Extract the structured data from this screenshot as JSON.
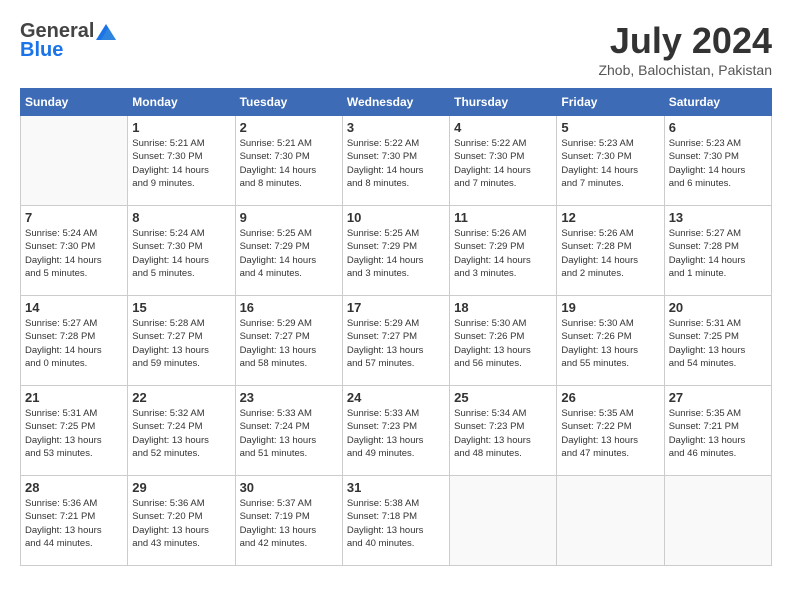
{
  "header": {
    "logo_general": "General",
    "logo_blue": "Blue",
    "month_title": "July 2024",
    "location": "Zhob, Balochistan, Pakistan"
  },
  "calendar": {
    "days_of_week": [
      "Sunday",
      "Monday",
      "Tuesday",
      "Wednesday",
      "Thursday",
      "Friday",
      "Saturday"
    ],
    "weeks": [
      [
        {
          "day": "",
          "info": ""
        },
        {
          "day": "1",
          "info": "Sunrise: 5:21 AM\nSunset: 7:30 PM\nDaylight: 14 hours\nand 9 minutes."
        },
        {
          "day": "2",
          "info": "Sunrise: 5:21 AM\nSunset: 7:30 PM\nDaylight: 14 hours\nand 8 minutes."
        },
        {
          "day": "3",
          "info": "Sunrise: 5:22 AM\nSunset: 7:30 PM\nDaylight: 14 hours\nand 8 minutes."
        },
        {
          "day": "4",
          "info": "Sunrise: 5:22 AM\nSunset: 7:30 PM\nDaylight: 14 hours\nand 7 minutes."
        },
        {
          "day": "5",
          "info": "Sunrise: 5:23 AM\nSunset: 7:30 PM\nDaylight: 14 hours\nand 7 minutes."
        },
        {
          "day": "6",
          "info": "Sunrise: 5:23 AM\nSunset: 7:30 PM\nDaylight: 14 hours\nand 6 minutes."
        }
      ],
      [
        {
          "day": "7",
          "info": "Sunrise: 5:24 AM\nSunset: 7:30 PM\nDaylight: 14 hours\nand 5 minutes."
        },
        {
          "day": "8",
          "info": "Sunrise: 5:24 AM\nSunset: 7:30 PM\nDaylight: 14 hours\nand 5 minutes."
        },
        {
          "day": "9",
          "info": "Sunrise: 5:25 AM\nSunset: 7:29 PM\nDaylight: 14 hours\nand 4 minutes."
        },
        {
          "day": "10",
          "info": "Sunrise: 5:25 AM\nSunset: 7:29 PM\nDaylight: 14 hours\nand 3 minutes."
        },
        {
          "day": "11",
          "info": "Sunrise: 5:26 AM\nSunset: 7:29 PM\nDaylight: 14 hours\nand 3 minutes."
        },
        {
          "day": "12",
          "info": "Sunrise: 5:26 AM\nSunset: 7:28 PM\nDaylight: 14 hours\nand 2 minutes."
        },
        {
          "day": "13",
          "info": "Sunrise: 5:27 AM\nSunset: 7:28 PM\nDaylight: 14 hours\nand 1 minute."
        }
      ],
      [
        {
          "day": "14",
          "info": "Sunrise: 5:27 AM\nSunset: 7:28 PM\nDaylight: 14 hours\nand 0 minutes."
        },
        {
          "day": "15",
          "info": "Sunrise: 5:28 AM\nSunset: 7:27 PM\nDaylight: 13 hours\nand 59 minutes."
        },
        {
          "day": "16",
          "info": "Sunrise: 5:29 AM\nSunset: 7:27 PM\nDaylight: 13 hours\nand 58 minutes."
        },
        {
          "day": "17",
          "info": "Sunrise: 5:29 AM\nSunset: 7:27 PM\nDaylight: 13 hours\nand 57 minutes."
        },
        {
          "day": "18",
          "info": "Sunrise: 5:30 AM\nSunset: 7:26 PM\nDaylight: 13 hours\nand 56 minutes."
        },
        {
          "day": "19",
          "info": "Sunrise: 5:30 AM\nSunset: 7:26 PM\nDaylight: 13 hours\nand 55 minutes."
        },
        {
          "day": "20",
          "info": "Sunrise: 5:31 AM\nSunset: 7:25 PM\nDaylight: 13 hours\nand 54 minutes."
        }
      ],
      [
        {
          "day": "21",
          "info": "Sunrise: 5:31 AM\nSunset: 7:25 PM\nDaylight: 13 hours\nand 53 minutes."
        },
        {
          "day": "22",
          "info": "Sunrise: 5:32 AM\nSunset: 7:24 PM\nDaylight: 13 hours\nand 52 minutes."
        },
        {
          "day": "23",
          "info": "Sunrise: 5:33 AM\nSunset: 7:24 PM\nDaylight: 13 hours\nand 51 minutes."
        },
        {
          "day": "24",
          "info": "Sunrise: 5:33 AM\nSunset: 7:23 PM\nDaylight: 13 hours\nand 49 minutes."
        },
        {
          "day": "25",
          "info": "Sunrise: 5:34 AM\nSunset: 7:23 PM\nDaylight: 13 hours\nand 48 minutes."
        },
        {
          "day": "26",
          "info": "Sunrise: 5:35 AM\nSunset: 7:22 PM\nDaylight: 13 hours\nand 47 minutes."
        },
        {
          "day": "27",
          "info": "Sunrise: 5:35 AM\nSunset: 7:21 PM\nDaylight: 13 hours\nand 46 minutes."
        }
      ],
      [
        {
          "day": "28",
          "info": "Sunrise: 5:36 AM\nSunset: 7:21 PM\nDaylight: 13 hours\nand 44 minutes."
        },
        {
          "day": "29",
          "info": "Sunrise: 5:36 AM\nSunset: 7:20 PM\nDaylight: 13 hours\nand 43 minutes."
        },
        {
          "day": "30",
          "info": "Sunrise: 5:37 AM\nSunset: 7:19 PM\nDaylight: 13 hours\nand 42 minutes."
        },
        {
          "day": "31",
          "info": "Sunrise: 5:38 AM\nSunset: 7:18 PM\nDaylight: 13 hours\nand 40 minutes."
        },
        {
          "day": "",
          "info": ""
        },
        {
          "day": "",
          "info": ""
        },
        {
          "day": "",
          "info": ""
        }
      ]
    ]
  }
}
